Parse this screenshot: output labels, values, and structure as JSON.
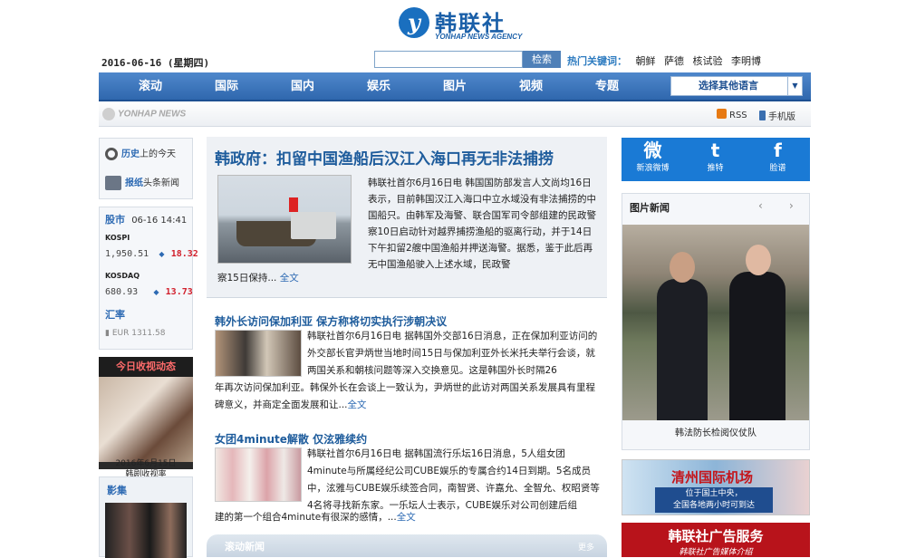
{
  "brand": {
    "name_cn": "韩联社",
    "name_en": "YONHAP NEWS AGENCY",
    "sub_logo": "YONHAP NEWS"
  },
  "header": {
    "date": "2016-06-16 (星期四)",
    "search_placeholder": "",
    "search_button": "检索",
    "hot_label": "热门关键词：",
    "hot_keywords": [
      "朝鲜",
      "萨德",
      "核试验",
      "李明博"
    ]
  },
  "nav": {
    "items": [
      "滚动",
      "国际",
      "国内",
      "娱乐",
      "图片",
      "视频",
      "专题"
    ],
    "language_select": "选择其他语言"
  },
  "subbar": {
    "rss": "RSS",
    "mobile": "手机版"
  },
  "sidebar": {
    "history_bold": "历史",
    "history_rest": "上的今天",
    "papers_bold": "报纸",
    "papers_rest": "头条新闻",
    "stock_label": "股市",
    "stock_time": "06-16 14:41",
    "indices": [
      {
        "name": "KOSPI",
        "value": "1,950.51",
        "change": "18.32"
      },
      {
        "name": "KOSDAQ",
        "value": "680.93",
        "change": "13.73"
      }
    ],
    "fx_label": "汇率",
    "fx_text": "EUR 1311.58",
    "star_title": "今日收视动态",
    "star_caption_line1": "2016年6月15日",
    "star_caption_line2": "韩剧收视率",
    "gallery_title": "影集"
  },
  "lead": {
    "title": "韩政府：扣留中国渔船后汉江入海口再无非法捕捞",
    "body": "韩联社首尔6月16日电 韩国国防部发言人文尚均16日表示，目前韩国汉江入海口中立水域没有非法捕捞的中国船只。由韩军及海警、联合国军司令部组建的民政警察10日启动针对越界捕捞渔船的驱离行动，并于14日下午扣留2艘中国渔船并押送海警。据悉，鉴于此后再无中国渔船驶入上述水域，民政警",
    "body_tail": "察15日保持...",
    "more": "全文"
  },
  "news": [
    {
      "title": "韩外长访问保加利亚 保方称将切实执行涉朝决议",
      "body": "韩联社首尔6月16日电 据韩国外交部16日消息，正在保加利亚访问的外交部长官尹炳世当地时间15日与保加利亚外长米托夫举行会谈，就两国关系和朝核问题等深入交换意见。这是韩国外长时隔26",
      "tail": "年再次访问保加利亚。韩保外长在会谈上一致认为，尹炳世的此访对两国关系发展具有里程碑意义，并商定全面发展和让...",
      "more": "全文"
    },
    {
      "title": "女团4minute解散 仅泫雅续约",
      "body": "韩联社首尔6月16日电 据韩国流行乐坛16日消息，5人组女团4minute与所属经纪公司CUBE娱乐的专属合约14日到期。5名成员中，泫雅与CUBE娱乐续签合同，南智贤、许嘉允、全智允、权昭贤等4名将寻找新东家。一乐坛人士表示，CUBE娱乐对公司创建后组",
      "tail": "建的第一个组合4minute有很深的感情，...",
      "more": "全文"
    }
  ],
  "scroll_news": {
    "title": "滚动新闻",
    "more": "更多"
  },
  "social": [
    {
      "glyph": "微",
      "label": "新浪微博"
    },
    {
      "glyph": "t",
      "label": "推特"
    },
    {
      "glyph": "f",
      "label": "脸谱"
    }
  ],
  "photo_news": {
    "title": "图片新闻",
    "caption": "韩法防长检阅仪仗队",
    "prev": "‹",
    "next": "›"
  },
  "ads": [
    {
      "title": "清州国际机场",
      "sub1": "位于国土中央，",
      "sub2": "全国各地两小时可到达"
    },
    {
      "title": "韩联社广告服务",
      "sub": "韩联社广告媒体介绍"
    }
  ]
}
